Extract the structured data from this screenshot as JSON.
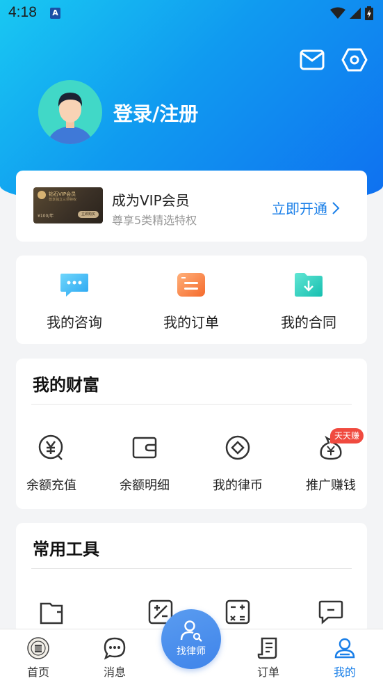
{
  "status": {
    "time": "4:18",
    "notif_letter": "A"
  },
  "header": {
    "login_label": "登录/注册"
  },
  "vip": {
    "title": "成为VIP会员",
    "subtitle": "尊享5类精选特权",
    "action": "立即开通",
    "card_title": "钻石VIP会员",
    "card_sub": "尊享独立三项特权",
    "card_price": "¥100/年",
    "card_button": "立即购买"
  },
  "quick": [
    {
      "label": "我的咨询",
      "icon": "chat-bubble-icon"
    },
    {
      "label": "我的订单",
      "icon": "order-doc-icon"
    },
    {
      "label": "我的合同",
      "icon": "contract-folder-icon"
    }
  ],
  "wealth": {
    "title": "我的财富",
    "items": [
      {
        "label": "余额充值",
        "icon": "yuan-recharge-icon"
      },
      {
        "label": "余额明细",
        "icon": "wallet-icon"
      },
      {
        "label": "我的律币",
        "icon": "coin-icon"
      },
      {
        "label": "推广赚钱",
        "icon": "money-bag-icon"
      }
    ],
    "badge": "天天赚"
  },
  "tools": {
    "title": "常用工具"
  },
  "tabbar": {
    "items": [
      {
        "label": "首页",
        "icon": "home-emblem-icon"
      },
      {
        "label": "消息",
        "icon": "message-icon"
      },
      {
        "label": "订单",
        "icon": "order-icon"
      },
      {
        "label": "我的",
        "icon": "profile-icon"
      }
    ],
    "center_label": "找律师"
  },
  "colors": {
    "accent": "#1a7fe8",
    "badge": "#f04a3f",
    "hero_start": "#19c8f2",
    "hero_end": "#0f6ff0"
  }
}
